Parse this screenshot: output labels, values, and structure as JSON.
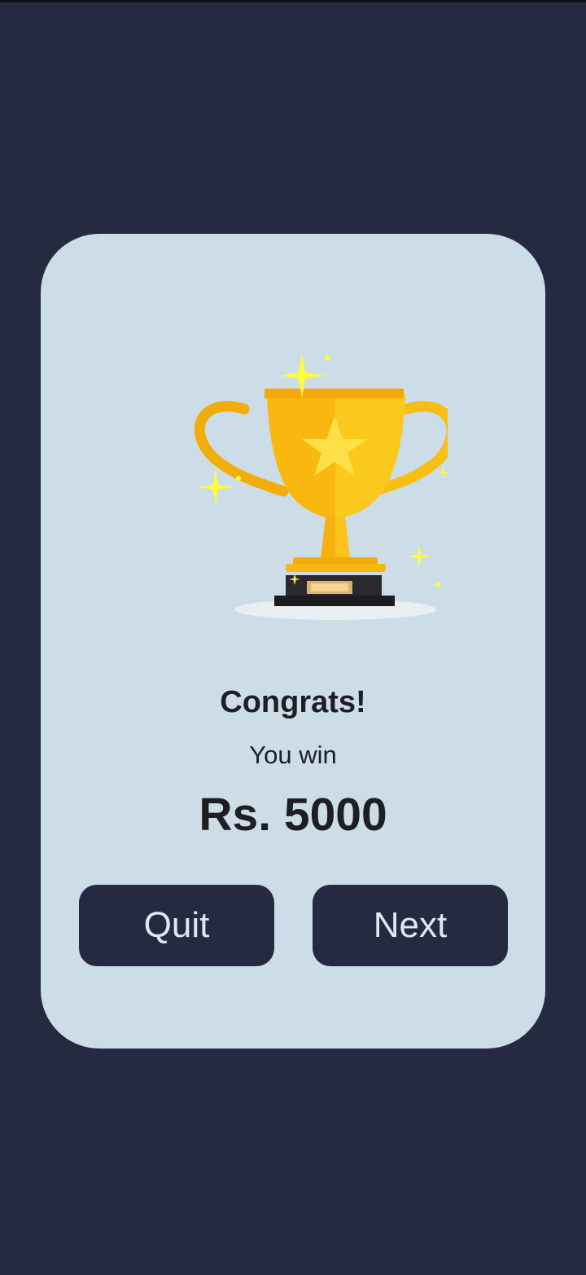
{
  "result": {
    "title": "Congrats!",
    "subtitle": "You win",
    "amount": "Rs. 5000"
  },
  "actions": {
    "quit_label": "Quit",
    "next_label": "Next"
  },
  "trophy": {
    "icon": "trophy-icon",
    "gold": "#f9b80f",
    "star": "#fde047"
  },
  "colors": {
    "background": "#252a41",
    "card": "#cddde7",
    "button": "#252a41",
    "button_text": "#dfe8f0",
    "text": "#1d1f24"
  }
}
